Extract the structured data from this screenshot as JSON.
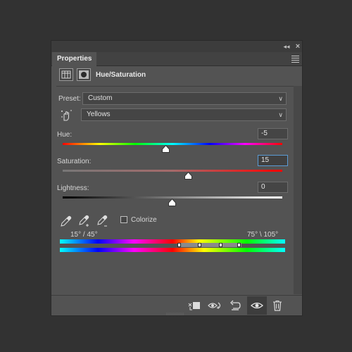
{
  "panel": {
    "tab_label": "Properties",
    "title": "Hue/Saturation"
  },
  "preset": {
    "label": "Preset:",
    "value": "Custom"
  },
  "channel": {
    "value": "Yellows"
  },
  "hue": {
    "label": "Hue:",
    "value": "-5",
    "min": -180,
    "max": 180
  },
  "saturation": {
    "label": "Saturation:",
    "value": "15",
    "min": -100,
    "max": 100
  },
  "lightness": {
    "label": "Lightness:",
    "value": "0",
    "min": -100,
    "max": 100
  },
  "colorize": {
    "label": "Colorize",
    "checked": false
  },
  "range": {
    "left_label": "15° /  45°",
    "right_label": "75° \\  105°"
  },
  "icons": {
    "collapse": "double-chevron-left-icon",
    "close": "close-icon",
    "menu": "panel-menu-icon",
    "eyedropper": "eyedropper-icon",
    "eyedropper_add": "eyedropper-plus-icon",
    "eyedropper_sub": "eyedropper-minus-icon",
    "target": "on-image-adjust-hand-icon",
    "clip": "clip-to-layer-icon",
    "view_prev": "view-previous-state-icon",
    "reset": "reset-icon",
    "visibility": "eye-icon",
    "delete": "trash-icon"
  },
  "colors": {
    "panel_bg": "#535353",
    "app_bg": "#323232",
    "focus_border": "#5b9bd5"
  }
}
